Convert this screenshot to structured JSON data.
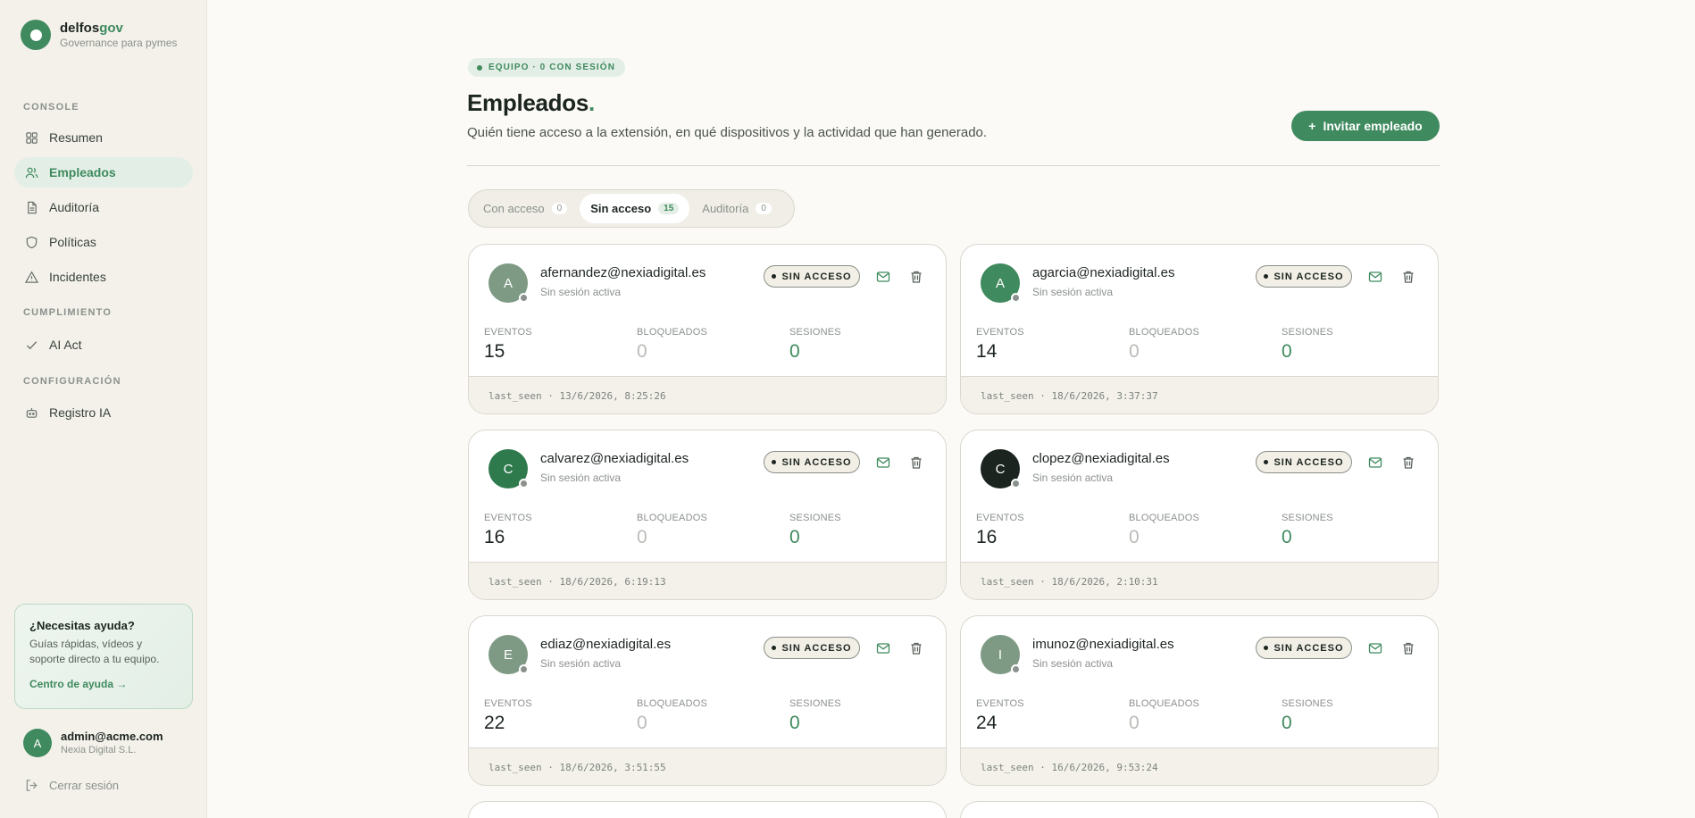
{
  "brand": {
    "name_main": "delfos",
    "name_accent": "gov",
    "tagline": "Governance para pymes"
  },
  "sidebar": {
    "sections": [
      {
        "title": "CONSOLE",
        "items": [
          {
            "label": "Resumen",
            "icon": "grid-icon"
          },
          {
            "label": "Empleados",
            "icon": "users-icon",
            "active": true
          },
          {
            "label": "Auditoría",
            "icon": "document-icon"
          },
          {
            "label": "Políticas",
            "icon": "shield-icon"
          },
          {
            "label": "Incidentes",
            "icon": "warning-icon"
          }
        ]
      },
      {
        "title": "CUMPLIMIENTO",
        "items": [
          {
            "label": "AI Act",
            "icon": "check-icon"
          }
        ]
      },
      {
        "title": "CONFIGURACIÓN",
        "items": [
          {
            "label": "Registro IA",
            "icon": "robot-icon"
          }
        ]
      }
    ],
    "help": {
      "title": "¿Necesitas ayuda?",
      "text": "Guías rápidas, vídeos y soporte directo a tu equipo.",
      "link": "Centro de ayuda →"
    },
    "user": {
      "initial": "A",
      "email": "admin@acme.com",
      "org": "Nexia Digital S.L."
    },
    "logout": "Cerrar sesión"
  },
  "header": {
    "badge": "EQUIPO · 0 CON SESIÓN",
    "title": "Empleados",
    "title_accent": ".",
    "subtitle": "Quién tiene acceso a la extensión, en qué dispositivos y la actividad que han generado.",
    "invite_label": "Invitar empleado",
    "invite_icon": "+"
  },
  "tabs": [
    {
      "label": "Con acceso",
      "count": "0"
    },
    {
      "label": "Sin acceso",
      "count": "15",
      "active": true
    },
    {
      "label": "Auditoría",
      "count": "0"
    }
  ],
  "metric_labels": {
    "events": "EVENTOS",
    "blocked": "BLOQUEADOS",
    "sessions": "SESIONES"
  },
  "access_label": "SIN ACCESO",
  "employees": [
    {
      "initial": "A",
      "avatar_color": "#7e9a84",
      "email": "afernandez@nexiadigital.es",
      "session": "Sin sesión activa",
      "events": "15",
      "blocked": "0",
      "sessions": "0",
      "last_seen": "last_seen · 13/6/2026, 8:25:26"
    },
    {
      "initial": "A",
      "avatar_color": "#3f8a5e",
      "email": "agarcia@nexiadigital.es",
      "session": "Sin sesión activa",
      "events": "14",
      "blocked": "0",
      "sessions": "0",
      "last_seen": "last_seen · 18/6/2026, 3:37:37"
    },
    {
      "initial": "C",
      "avatar_color": "#2f7a4d",
      "email": "calvarez@nexiadigital.es",
      "session": "Sin sesión activa",
      "events": "16",
      "blocked": "0",
      "sessions": "0",
      "last_seen": "last_seen · 18/6/2026, 6:19:13"
    },
    {
      "initial": "C",
      "avatar_color": "#1c2420",
      "email": "clopez@nexiadigital.es",
      "session": "Sin sesión activa",
      "events": "16",
      "blocked": "0",
      "sessions": "0",
      "last_seen": "last_seen · 18/6/2026, 2:10:31"
    },
    {
      "initial": "E",
      "avatar_color": "#7e9a84",
      "email": "ediaz@nexiadigital.es",
      "session": "Sin sesión activa",
      "events": "22",
      "blocked": "0",
      "sessions": "0",
      "last_seen": "last_seen · 18/6/2026, 3:51:55"
    },
    {
      "initial": "I",
      "avatar_color": "#7e9a84",
      "email": "imunoz@nexiadigital.es",
      "session": "Sin sesión activa",
      "events": "24",
      "blocked": "0",
      "sessions": "0",
      "last_seen": "last_seen · 16/6/2026, 9:53:24"
    }
  ],
  "colors": {
    "accent": "#3f8a5e",
    "accent_soft": "#e3efe6",
    "sidebar_bg": "#f3f1ea",
    "page_bg": "#fbfaf6"
  }
}
